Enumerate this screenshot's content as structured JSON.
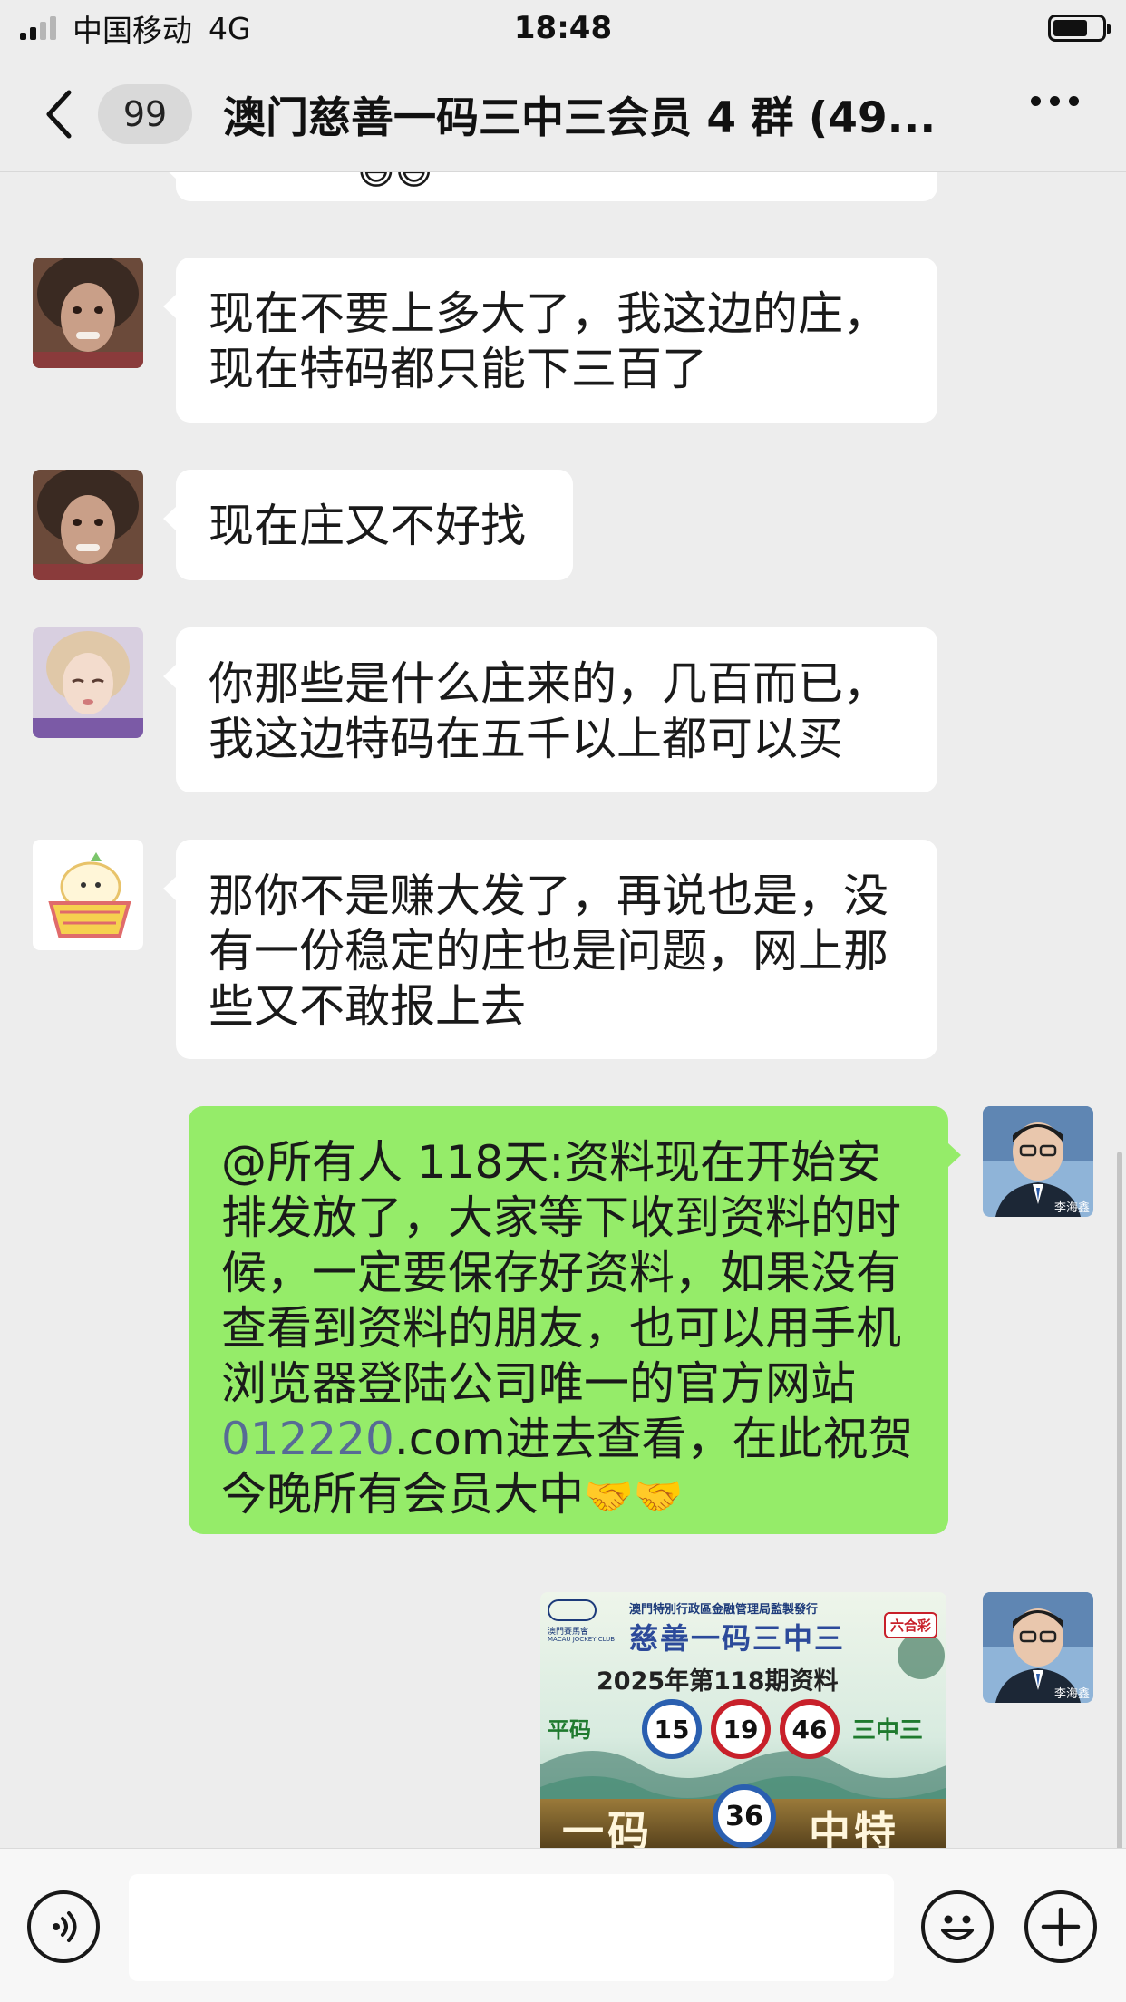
{
  "status_bar": {
    "carrier": "中国移动",
    "network": "4G",
    "time": "18:48"
  },
  "nav": {
    "unread_count": "99",
    "title": "澳门慈善一码三中三会员 4 群 (49..."
  },
  "messages": [
    {
      "text": "现在不要上多大了，我这边的庄，现在特码都只能下三百了"
    },
    {
      "text": "现在庄又不好找"
    },
    {
      "text": "你那些是什么庄来的，几百而已，我这边特码在五千以上都可以买"
    },
    {
      "text": "那你不是赚大发了，再说也是，没有一份稳定的庄也是问题，网上那些又不敢报上去"
    },
    {
      "text_before": "@所有人 118天:资料现在开始安排发放了，大家等下收到资料的时候，一定要保存好资料，如果没有查看到资料的朋友，也可以用手机浏览器登陆公司唯一的官方网站",
      "link": "012220",
      "text_after": ".com进去查看，在此祝贺今晚所有会员大中",
      "emoji": "🤝🤝"
    }
  ],
  "sender_caption": "李海鑫",
  "image_card": {
    "header": "澳門特別行政區金融管理局監製發行",
    "club": "澳門賽馬會",
    "club_en": "MACAU JOCKEY CLUB",
    "badge": "六合彩",
    "title": "慈善一码三中三",
    "issue": "2025年第118期资料",
    "left_label": "平码",
    "numbers": [
      "15",
      "19",
      "46"
    ],
    "right_label": "三中三",
    "bottom_left": "一码",
    "special": "36",
    "bottom_right": "中特"
  },
  "colors": {
    "background": "#ededed",
    "bubble_in": "#ffffff",
    "bubble_out": "#95ec69",
    "link": "#576b95"
  }
}
